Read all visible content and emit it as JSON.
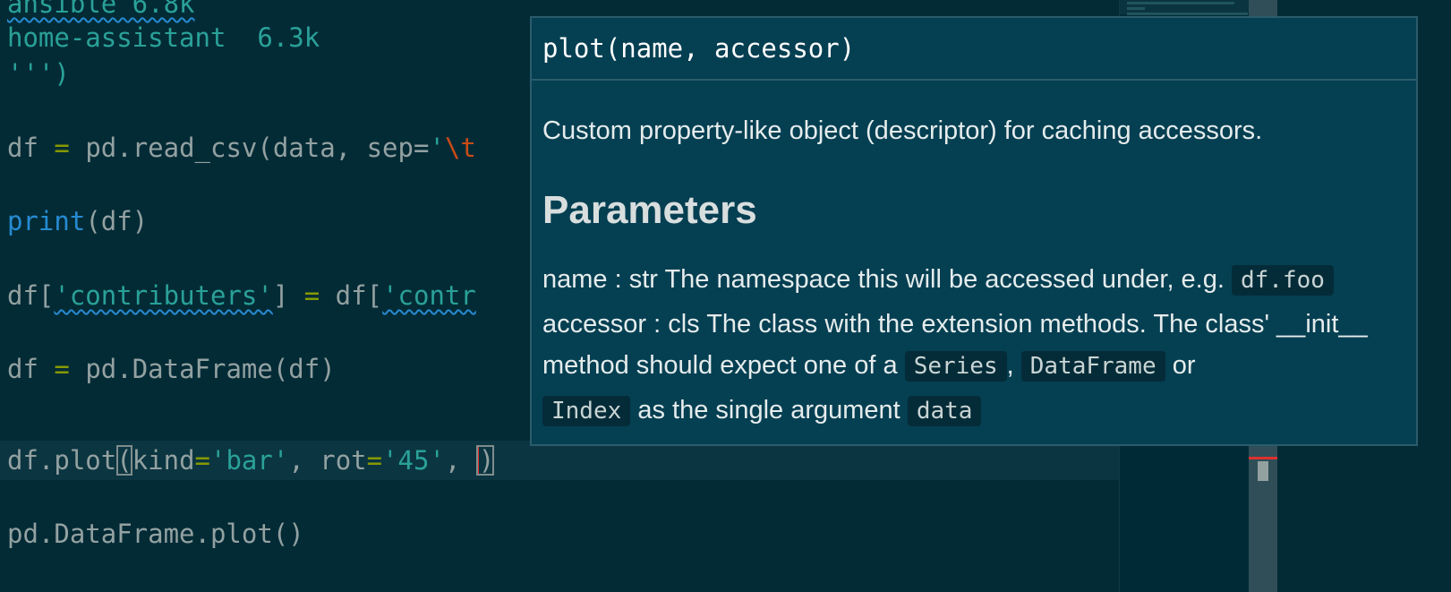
{
  "editor": {
    "lines": {
      "l1": "ansible 6.8k",
      "l2": "home-assistant  6.3k",
      "l3": "''')",
      "df_assign": "df",
      "eq": "=",
      "read_csv": " pd.read_csv(data, sep=",
      "sep_quote": "'",
      "sep_esc": "\\t",
      "print_kw": "print",
      "print_rest": "(df)",
      "contrib_open": "df[",
      "contrib_str1": "'contributers'",
      "contrib_mid": "] ",
      "contrib_rhs": " df[",
      "contrib_str2": "'contr",
      "dataframe_rest": " pd.DataFrame(df)",
      "plot_prefix": "df.plot",
      "plot_open": "(",
      "plot_kind": "kind",
      "plot_kind_val": "'bar'",
      "plot_sep1": ", rot",
      "plot_rot_val": "'45'",
      "plot_sep2": ", ",
      "plot_close": ")",
      "last": "pd.DataFrame.plot()"
    }
  },
  "popup": {
    "signature": "plot(name, accessor)",
    "description": "Custom property-like object (descriptor) for caching accessors.",
    "heading": "Parameters",
    "name_text": "name : str The namespace this will be accessed under, e.g.",
    "name_code": "df.foo",
    "accessor_text": "accessor : cls The class with the extension methods. The class' __init__",
    "method_text": "method should expect one of a",
    "code_series": "Series",
    "comma": ",",
    "code_dataframe": "DataFrame",
    "or_text": "or",
    "code_index": "Index",
    "single_text": "as the single argument",
    "code_data": "data"
  },
  "colors": {
    "background": "#032b36",
    "string": "#2aa198",
    "operator": "#859900",
    "keyword": "#268bd2",
    "escape": "#cb4b16",
    "caret": "#dc322f"
  }
}
